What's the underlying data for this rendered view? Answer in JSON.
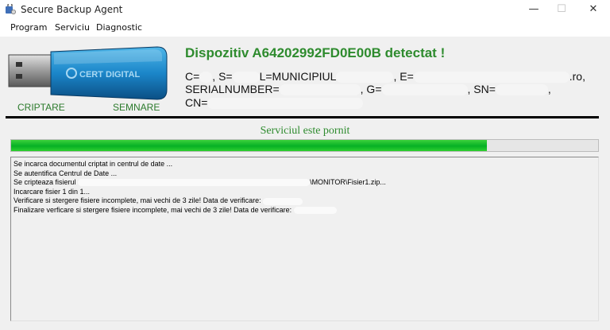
{
  "window": {
    "title": "Secure Backup Agent",
    "controls": {
      "minimize": "—",
      "maximize": "☐",
      "close": "✕"
    }
  },
  "menu": {
    "items": [
      "Program",
      "Serviciu",
      "Diagnostic"
    ]
  },
  "header": {
    "device_title": "Dispozitiv A64202992FD0E00B detectat !",
    "cert_line1": {
      "a": "C=",
      "b": ", S=",
      "c": "L=MUNICIPIUL",
      "d": ", E=",
      "e": ".ro,"
    },
    "cert_line2": {
      "a": "SERIALNUMBER=",
      "b": ", G=",
      "c": ", SN=",
      "d": ","
    },
    "cert_line3": {
      "a": "CN="
    },
    "left_label": "CRIPTARE",
    "right_label": "SEMNARE",
    "usb_brand": "CERT DIGITAL"
  },
  "status": {
    "text": "Serviciul este pornit",
    "progress": 0.81,
    "fill_color": "#06b025"
  },
  "log": {
    "lines": [
      "Se incarca documentul criptat in centrul de date ...",
      "Se autentifica Centrul de Date ...",
      {
        "prefix": "Se cripteaza fisierul",
        "suffix": "\\MONITOR\\Fisier1.zip..."
      },
      "Incarcare fisier  1 din 1...",
      "Verificare si stergere fisiere incomplete, mai vechi de 3 zile! Data de verificare:",
      "Finalizare verficare si stergere fisiere incomplete, mai vechi de 3 zile! Data de verificare:"
    ]
  },
  "colors": {
    "accent_green": "#2e8b2e",
    "progress_green": "#06b025"
  }
}
